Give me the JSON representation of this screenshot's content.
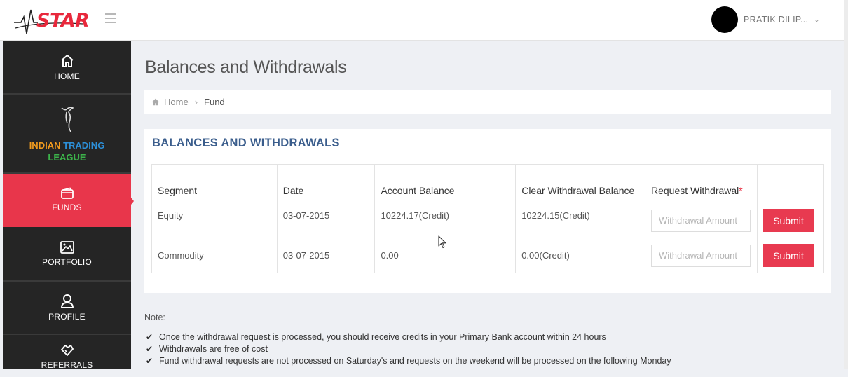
{
  "brand": {
    "logo_text": "STAR"
  },
  "user": {
    "name": "PRATIK DILIP..."
  },
  "sidebar": {
    "items": [
      {
        "label": "HOME",
        "icon": "home-icon"
      },
      {
        "label_parts": [
          "INDIAN",
          "TRADING",
          "LEAGUE"
        ],
        "icon": "bull-icon"
      },
      {
        "label": "FUNDS",
        "icon": "wallet-icon",
        "active": true
      },
      {
        "label": "PORTFOLIO",
        "icon": "image-icon"
      },
      {
        "label": "PROFILE",
        "icon": "user-icon"
      },
      {
        "label": "REFERRALS",
        "icon": "handshake-icon"
      }
    ]
  },
  "page": {
    "title": "Balances and Withdrawals"
  },
  "breadcrumb": {
    "home": "Home",
    "current": "Fund"
  },
  "panel": {
    "title": "BALANCES AND WITHDRAWALS",
    "columns": [
      "Segment",
      "Date",
      "Account Balance",
      "Clear Withdrawal Balance",
      "Request Withdrawal",
      ""
    ],
    "required_mark": "*",
    "rows": [
      {
        "segment": "Equity",
        "date": "03-07-2015",
        "account_balance": "10224.17(Credit)",
        "clear_withdrawal_balance": "10224.15(Credit)",
        "input_placeholder": "Withdrawal Amount",
        "button": "Submit"
      },
      {
        "segment": "Commodity",
        "date": "03-07-2015",
        "account_balance": "0.00",
        "clear_withdrawal_balance": "0.00(Credit)",
        "input_placeholder": "Withdrawal Amount",
        "button": "Submit"
      }
    ]
  },
  "notes": {
    "label": "Note:",
    "items": [
      "Once the withdrawal request is processed, you should receive credits in your Primary Bank account within 24 hours",
      "Withdrawals are free of cost",
      "Fund withdrawal requests are not processed on Saturday's and requests on the weekend will be processed on the following Monday"
    ]
  },
  "colors": {
    "accent": "#e8364b",
    "sidebar_bg": "#252525",
    "panel_title": "#3a5d8c"
  }
}
